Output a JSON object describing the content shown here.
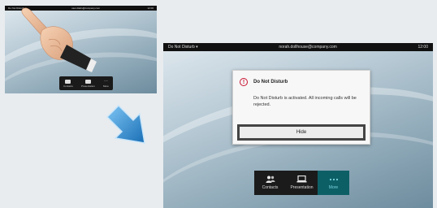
{
  "small_screen": {
    "status_left": "Do Not Disturb",
    "status_center": "user.dialin@company.com",
    "status_right": "12:00",
    "dock": [
      {
        "label": "Contacts",
        "icon": "contacts-icon"
      },
      {
        "label": "Presentation",
        "icon": "presentation-icon"
      },
      {
        "label": "More",
        "icon": "more-icon"
      }
    ]
  },
  "large_screen": {
    "status_left": "Do Not Disturb ▾",
    "status_center": "norah.dollhouse@company.com",
    "status_right": "12:00",
    "dialog": {
      "title": "Do Not Disturb",
      "message": "Do Not Disturb is activated. All incoming calls will be rejected.",
      "button": "Hide"
    },
    "dock": [
      {
        "label": "Contacts",
        "icon": "contacts-icon"
      },
      {
        "label": "Presentation",
        "icon": "presentation-icon"
      },
      {
        "label": "More",
        "icon": "more-icon"
      }
    ]
  },
  "colors": {
    "warning": "#c8102e",
    "active_tab": "#0d5f66",
    "arrow": "#2d8fd6"
  }
}
